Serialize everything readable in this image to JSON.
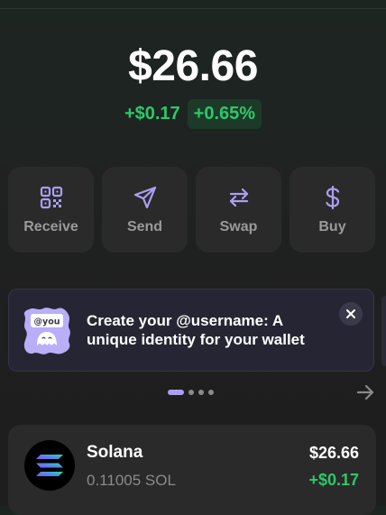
{
  "balance": {
    "total": "$26.66",
    "change_abs": "+$0.17",
    "change_pct": "+0.65%"
  },
  "actions": [
    {
      "label": "Receive",
      "icon": "qr-code-icon"
    },
    {
      "label": "Send",
      "icon": "send-icon"
    },
    {
      "label": "Swap",
      "icon": "swap-icon"
    },
    {
      "label": "Buy",
      "icon": "dollar-icon"
    }
  ],
  "promo": {
    "badge": "@you",
    "text": "Create your @username: A unique identity for your wallet",
    "close_icon": "close-icon"
  },
  "carousel": {
    "active_index": 0,
    "count": 4
  },
  "tokens": [
    {
      "name": "Solana",
      "amount": "0.11005 SOL",
      "value": "$26.66",
      "change": "+$0.17"
    }
  ],
  "colors": {
    "accent": "#ab9ff2",
    "positive": "#2ec76a",
    "card": "#2a2a2a",
    "muted": "#9a9a9a"
  }
}
